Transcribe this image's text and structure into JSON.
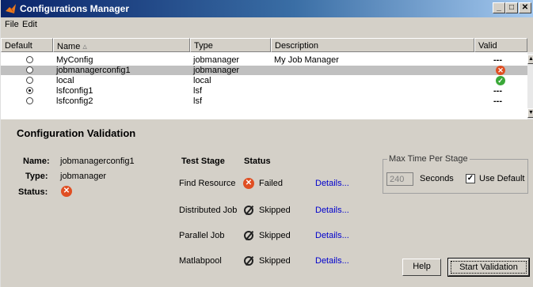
{
  "window": {
    "title": "Configurations Manager"
  },
  "menu": [
    "File",
    "Edit"
  ],
  "table": {
    "columns": [
      "Default",
      "Name",
      "Type",
      "Description",
      "Valid"
    ],
    "sort_indicator": "▵",
    "rows": [
      {
        "selected": false,
        "default": false,
        "name": "MyConfig",
        "type": "jobmanager",
        "description": "My Job Manager",
        "valid": "---",
        "valid_icon": ""
      },
      {
        "selected": true,
        "default": false,
        "name": "jobmanagerconfig1",
        "type": "jobmanager",
        "description": "",
        "valid": "",
        "valid_icon": "error-icon"
      },
      {
        "selected": false,
        "default": false,
        "name": "local",
        "type": "local",
        "description": "",
        "valid": "",
        "valid_icon": "check-icon"
      },
      {
        "selected": false,
        "default": true,
        "name": "lsfconfig1",
        "type": "lsf",
        "description": "",
        "valid": "---",
        "valid_icon": ""
      },
      {
        "selected": false,
        "default": false,
        "name": "lsfconfig2",
        "type": "lsf",
        "description": "",
        "valid": "---",
        "valid_icon": ""
      }
    ]
  },
  "validation": {
    "title": "Configuration Validation",
    "name_label": "Name:",
    "name_value": "jobmanagerconfig1",
    "type_label": "Type:",
    "type_value": "jobmanager",
    "status_label": "Status:",
    "status_icon": "error-icon",
    "header_stage": "Test Stage",
    "header_status": "Status",
    "details_label": "Details...",
    "stages": [
      {
        "name": "Find Resource",
        "status": "Failed",
        "icon": "error-icon"
      },
      {
        "name": "Distributed Job",
        "status": "Skipped",
        "icon": "skipped-icon"
      },
      {
        "name": "Parallel Job",
        "status": "Skipped",
        "icon": "skipped-icon"
      },
      {
        "name": "Matlabpool",
        "status": "Skipped",
        "icon": "skipped-icon"
      }
    ]
  },
  "max_time": {
    "legend": "Max Time Per Stage",
    "value": "240",
    "unit": "Seconds",
    "use_default_label": "Use Default",
    "use_default_checked": true
  },
  "buttons": {
    "help": "Help",
    "start": "Start Validation"
  },
  "colors": {
    "title_start": "#0a246a",
    "title_end": "#a6caf0",
    "link": "#0000cc",
    "error": "#e04e22",
    "ok": "#3aa838"
  }
}
